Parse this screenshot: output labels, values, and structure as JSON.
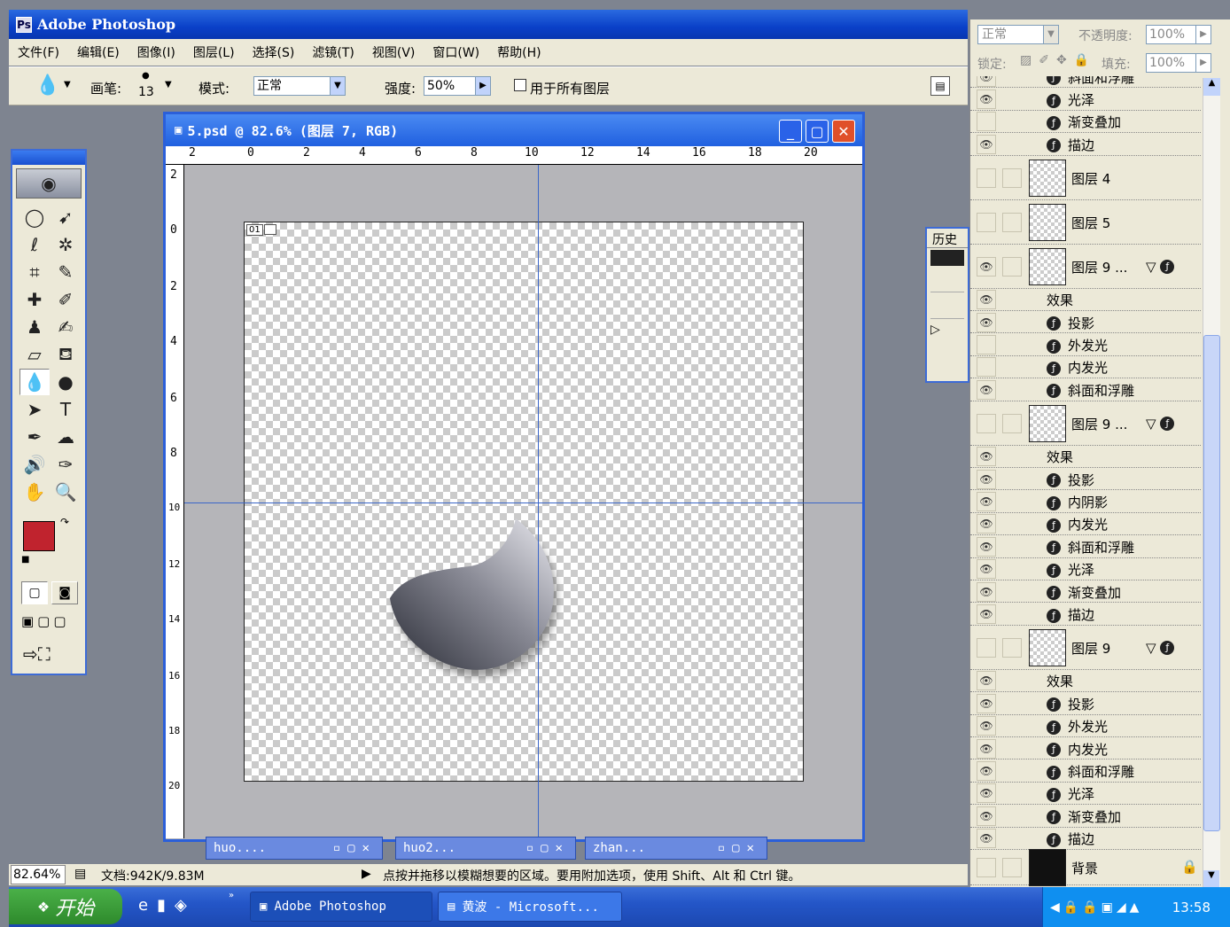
{
  "app": {
    "title": "Adobe Photoshop"
  },
  "menu": [
    "文件(F)",
    "编辑(E)",
    "图像(I)",
    "图层(L)",
    "选择(S)",
    "滤镜(T)",
    "视图(V)",
    "窗口(W)",
    "帮助(H)"
  ],
  "options": {
    "brush_label": "画笔:",
    "brush_size": "13",
    "mode_label": "模式:",
    "mode_value": "正常",
    "strength_label": "强度:",
    "strength_value": "50%",
    "all_layers_label": "用于所有图层"
  },
  "document": {
    "title": "5.psd @ 82.6% (图层 7, RGB)",
    "ruler_h": [
      "2",
      "0",
      "2",
      "4",
      "6",
      "8",
      "10",
      "12",
      "14",
      "16",
      "18",
      "20"
    ],
    "ruler_v": [
      "2",
      "0",
      "2",
      "4",
      "6",
      "8",
      "10",
      "12",
      "14",
      "16",
      "18",
      "20"
    ],
    "canvas_badge": "01"
  },
  "minimized_windows": [
    "huo....",
    "huo2...",
    "zhan..."
  ],
  "status": {
    "zoom": "82.64%",
    "doc_size": "文档:942K/9.83M",
    "hint": "点按并拖移以模糊想要的区域。要用附加选项，使用 Shift、Alt 和 Ctrl 键。"
  },
  "layers_panel": {
    "blend_mode": "正常",
    "opacity_label": "不透明度:",
    "opacity_value": "100%",
    "lock_label": "锁定:",
    "fill_label": "填充:",
    "fill_value": "100%",
    "rows": [
      {
        "kind": "fx",
        "name": "斜面和浮雕",
        "eye": true
      },
      {
        "kind": "fx",
        "name": "光泽",
        "eye": true
      },
      {
        "kind": "fx",
        "name": "渐变叠加",
        "eye": false
      },
      {
        "kind": "fx",
        "name": "描边",
        "eye": true
      },
      {
        "kind": "layer",
        "name": "图层 4",
        "eye": false
      },
      {
        "kind": "layer",
        "name": "图层 5",
        "eye": false
      },
      {
        "kind": "layer",
        "name": "图层 9 ...",
        "eye": true,
        "has_fx": true
      },
      {
        "kind": "effect",
        "name": "效果",
        "eye": true
      },
      {
        "kind": "fx",
        "name": "投影",
        "eye": true
      },
      {
        "kind": "fx",
        "name": "外发光",
        "eye": false
      },
      {
        "kind": "fx",
        "name": "内发光",
        "eye": false
      },
      {
        "kind": "fx",
        "name": "斜面和浮雕",
        "eye": true
      },
      {
        "kind": "layer",
        "name": "图层 9 ...",
        "eye": false,
        "has_fx": true
      },
      {
        "kind": "effect",
        "name": "效果",
        "eye": true
      },
      {
        "kind": "fx",
        "name": "投影",
        "eye": true
      },
      {
        "kind": "fx",
        "name": "内阴影",
        "eye": true
      },
      {
        "kind": "fx",
        "name": "内发光",
        "eye": true
      },
      {
        "kind": "fx",
        "name": "斜面和浮雕",
        "eye": true
      },
      {
        "kind": "fx",
        "name": "光泽",
        "eye": true
      },
      {
        "kind": "fx",
        "name": "渐变叠加",
        "eye": true
      },
      {
        "kind": "fx",
        "name": "描边",
        "eye": true
      },
      {
        "kind": "layer",
        "name": "图层 9",
        "eye": false,
        "has_fx": true
      },
      {
        "kind": "effect",
        "name": "效果",
        "eye": true
      },
      {
        "kind": "fx",
        "name": "投影",
        "eye": true
      },
      {
        "kind": "fx",
        "name": "外发光",
        "eye": true
      },
      {
        "kind": "fx",
        "name": "内发光",
        "eye": true
      },
      {
        "kind": "fx",
        "name": "斜面和浮雕",
        "eye": true
      },
      {
        "kind": "fx",
        "name": "光泽",
        "eye": true
      },
      {
        "kind": "fx",
        "name": "渐变叠加",
        "eye": true
      },
      {
        "kind": "fx",
        "name": "描边",
        "eye": true
      },
      {
        "kind": "background",
        "name": "背景",
        "eye": false
      }
    ]
  },
  "history_panel": {
    "title": "历史"
  },
  "taskbar": {
    "start": "开始",
    "tasks": [
      "Adobe Photoshop",
      "黄波 - Microsoft..."
    ],
    "clock": "13:58"
  },
  "colors": {
    "foreground": "#c0232e",
    "background": "#ffffff",
    "titlebar": "#0a40c8"
  }
}
